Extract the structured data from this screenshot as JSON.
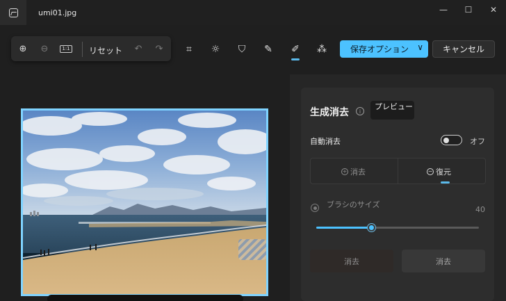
{
  "window": {
    "title": "umi01.jpg",
    "minimize_glyph": "—",
    "maximize_glyph": "☐",
    "close_glyph": "✕"
  },
  "toolbar": {
    "zoom_in_icon": "⊕",
    "zoom_out_icon": "⊖",
    "actual_size_label": "1:1",
    "reset_label": "リセット",
    "undo_icon": "↶",
    "redo_icon": "↷",
    "tools": {
      "crop_icon": "⌗",
      "adjust_icon": "☼",
      "filter_icon": "⛉",
      "markup_icon": "✎",
      "erase_icon": "✐",
      "background_icon": "⁂"
    },
    "save_label": "保存オプション",
    "save_chevron": "∨",
    "cancel_label": "キャンセル"
  },
  "panel": {
    "title": "生成消去",
    "info_glyph": "i",
    "preview_badge": "プレビュー",
    "auto_erase_label": "自動消去",
    "auto_erase_state": "オフ",
    "mode_erase_icon": "+",
    "mode_erase_label": "消去",
    "mode_restore_icon": "−",
    "mode_restore_label": "復元",
    "brush_size_label": "ブラシのサイズ",
    "brush_size_value": "40",
    "brush_size_fraction": 0.34,
    "action_erase_label": "消去",
    "action_erase_label_2": "消去"
  },
  "colors": {
    "accent": "#4cc2ff",
    "selection_border": "#7fd3ff",
    "background": "#1f1f1f",
    "panel": "#2d2d2d"
  }
}
